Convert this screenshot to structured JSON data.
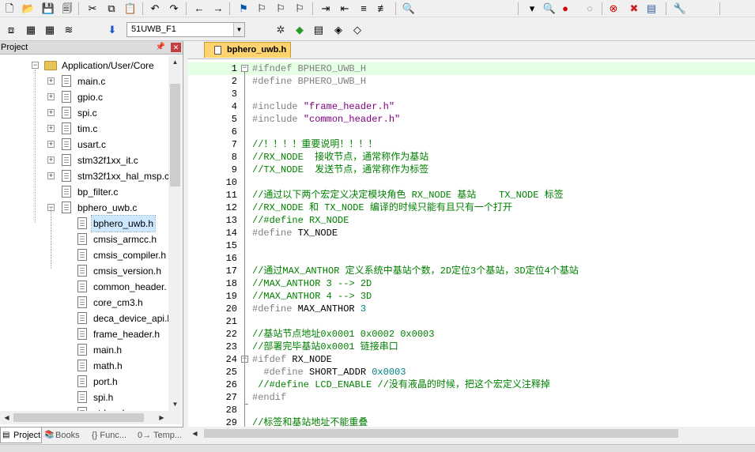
{
  "toolbar1": {
    "icons": [
      "new-file-icon",
      "open-folder-icon",
      "save-icon",
      "save-all-icon",
      "cut-icon",
      "copy-icon",
      "paste-icon",
      "undo-icon",
      "redo-icon",
      "nav-back-icon",
      "nav-forward-icon",
      "bookmark-icon",
      "prev-bookmark-icon",
      "next-bookmark-icon",
      "clear-bookmarks-icon",
      "indent-icon",
      "unindent-icon",
      "comment-icon",
      "uncomment-icon",
      "find-in-files-icon",
      "find-dropdown-icon",
      "debug-session-icon",
      "breakpoint-icon",
      "disable-breakpoint-icon",
      "kill-breakpoints-icon",
      "kill-all-icon",
      "window-layout-icon",
      "configure-icon"
    ]
  },
  "toolbar2": {
    "target": "51UWB_F1",
    "icons": [
      "translate-icon",
      "build-icon",
      "rebuild-icon",
      "batch-build-icon",
      "download-icon",
      "target-options-icon",
      "manage-components-icon",
      "select-packs-icon",
      "pack-installer-icon",
      "runtime-env-icon"
    ]
  },
  "panel": {
    "title": "Project",
    "tree": [
      {
        "label": "Application/User/Core",
        "type": "folder",
        "depth": 1,
        "expanded": true
      },
      {
        "label": "main.c",
        "type": "file",
        "depth": 2,
        "expander": true
      },
      {
        "label": "gpio.c",
        "type": "file",
        "depth": 2,
        "expander": true
      },
      {
        "label": "spi.c",
        "type": "file",
        "depth": 2,
        "expander": true
      },
      {
        "label": "tim.c",
        "type": "file",
        "depth": 2,
        "expander": true
      },
      {
        "label": "usart.c",
        "type": "file",
        "depth": 2,
        "expander": true
      },
      {
        "label": "stm32f1xx_it.c",
        "type": "file",
        "depth": 2,
        "expander": true
      },
      {
        "label": "stm32f1xx_hal_msp.c",
        "type": "file",
        "depth": 2,
        "expander": true
      },
      {
        "label": "bp_filter.c",
        "type": "file",
        "depth": 2,
        "expander": false
      },
      {
        "label": "bphero_uwb.c",
        "type": "file",
        "depth": 2,
        "expander": true,
        "expanded": true
      },
      {
        "label": "bphero_uwb.h",
        "type": "file",
        "depth": 3,
        "selected": true
      },
      {
        "label": "cmsis_armcc.h",
        "type": "file",
        "depth": 3
      },
      {
        "label": "cmsis_compiler.h",
        "type": "file",
        "depth": 3
      },
      {
        "label": "cmsis_version.h",
        "type": "file",
        "depth": 3
      },
      {
        "label": "common_header.",
        "type": "file",
        "depth": 3
      },
      {
        "label": "core_cm3.h",
        "type": "file",
        "depth": 3
      },
      {
        "label": "deca_device_api.h",
        "type": "file",
        "depth": 3
      },
      {
        "label": "frame_header.h",
        "type": "file",
        "depth": 3
      },
      {
        "label": "main.h",
        "type": "file",
        "depth": 3
      },
      {
        "label": "math.h",
        "type": "file",
        "depth": 3
      },
      {
        "label": "port.h",
        "type": "file",
        "depth": 3
      },
      {
        "label": "spi.h",
        "type": "file",
        "depth": 3
      },
      {
        "label": "stdarg.h",
        "type": "file",
        "depth": 3
      }
    ],
    "tabs": [
      {
        "label": "Project",
        "icon": "project-icon",
        "active": true
      },
      {
        "label": "Books",
        "icon": "books-icon",
        "active": false
      },
      {
        "label": "{} Func...",
        "icon": "functions-icon",
        "active": false
      },
      {
        "label": "0→ Temp...",
        "icon": "templates-icon",
        "active": false
      }
    ]
  },
  "editor": {
    "tab_label": "bphero_uwb.h",
    "lines": [
      {
        "n": "1",
        "fold": "box",
        "hl": true,
        "parts": [
          [
            "pre",
            "#ifndef BPHERO_UWB_H"
          ]
        ]
      },
      {
        "n": "2",
        "parts": [
          [
            "pre",
            "#define BPHERO_UWB_H"
          ]
        ]
      },
      {
        "n": "3",
        "parts": []
      },
      {
        "n": "4",
        "parts": [
          [
            "pre",
            "#include "
          ],
          [
            "str",
            "\"frame_header.h\""
          ]
        ]
      },
      {
        "n": "5",
        "parts": [
          [
            "pre",
            "#include "
          ],
          [
            "str",
            "\"common_header.h\""
          ]
        ]
      },
      {
        "n": "6",
        "parts": []
      },
      {
        "n": "7",
        "parts": [
          [
            "cmt",
            "//！！！！重要说明！！！！"
          ]
        ]
      },
      {
        "n": "8",
        "parts": [
          [
            "cmt",
            "//RX_NODE  接收节点，通常称作为基站"
          ]
        ]
      },
      {
        "n": "9",
        "parts": [
          [
            "cmt",
            "//TX_NODE  发送节点，通常称作为标签"
          ]
        ]
      },
      {
        "n": "10",
        "parts": []
      },
      {
        "n": "11",
        "parts": [
          [
            "cmt",
            "//通过以下两个宏定义决定模块角色 RX_NODE 基站    TX_NODE 标签"
          ]
        ]
      },
      {
        "n": "12",
        "parts": [
          [
            "cmt",
            "//RX_NODE 和 TX_NODE 编译的时候只能有且只有一个打开"
          ]
        ]
      },
      {
        "n": "13",
        "parts": [
          [
            "cmt",
            "//#define RX_NODE"
          ]
        ]
      },
      {
        "n": "14",
        "parts": [
          [
            "pre",
            "#define "
          ],
          [
            "plain",
            "TX_NODE"
          ]
        ]
      },
      {
        "n": "15",
        "parts": []
      },
      {
        "n": "16",
        "parts": []
      },
      {
        "n": "17",
        "parts": [
          [
            "cmt",
            "//通过MAX_ANTHOR 定义系统中基站个数，2D定位3个基站，3D定位4个基站"
          ]
        ]
      },
      {
        "n": "18",
        "parts": [
          [
            "cmt",
            "//MAX_ANTHOR 3 --> 2D"
          ]
        ]
      },
      {
        "n": "19",
        "parts": [
          [
            "cmt",
            "//MAX_ANTHOR 4 --> 3D"
          ]
        ]
      },
      {
        "n": "20",
        "parts": [
          [
            "pre",
            "#define "
          ],
          [
            "plain",
            "MAX_ANTHOR "
          ],
          [
            "num",
            "3"
          ]
        ]
      },
      {
        "n": "21",
        "parts": []
      },
      {
        "n": "22",
        "parts": [
          [
            "cmt",
            "//基站节点地址0x0001 0x0002 0x0003"
          ]
        ]
      },
      {
        "n": "23",
        "parts": [
          [
            "cmt",
            "//部署完毕基站0x0001 链接串口"
          ]
        ]
      },
      {
        "n": "24",
        "fold": "box",
        "parts": [
          [
            "pre",
            "#ifdef "
          ],
          [
            "plain",
            "RX_NODE"
          ]
        ]
      },
      {
        "n": "25",
        "parts": [
          [
            "pre",
            "  #define "
          ],
          [
            "plain",
            "SHORT_ADDR "
          ],
          [
            "num",
            "0x0003"
          ]
        ]
      },
      {
        "n": "26",
        "parts": [
          [
            "cmt",
            " //#define LCD_ENABLE //没有液晶的时候，把这个宏定义注释掉"
          ]
        ]
      },
      {
        "n": "27",
        "fold": "end",
        "parts": [
          [
            "pre",
            "#endif"
          ]
        ]
      },
      {
        "n": "28",
        "fold": "line",
        "parts": []
      },
      {
        "n": "29",
        "parts": [
          [
            "cmt",
            "//标签和基站地址不能重叠"
          ]
        ]
      }
    ]
  },
  "colors": {
    "preprocessor": "#808080",
    "string": "#800080",
    "comment": "#008000",
    "number": "#008080",
    "active_line": "#e5ffe5",
    "file_tab": "#ffd36e"
  }
}
